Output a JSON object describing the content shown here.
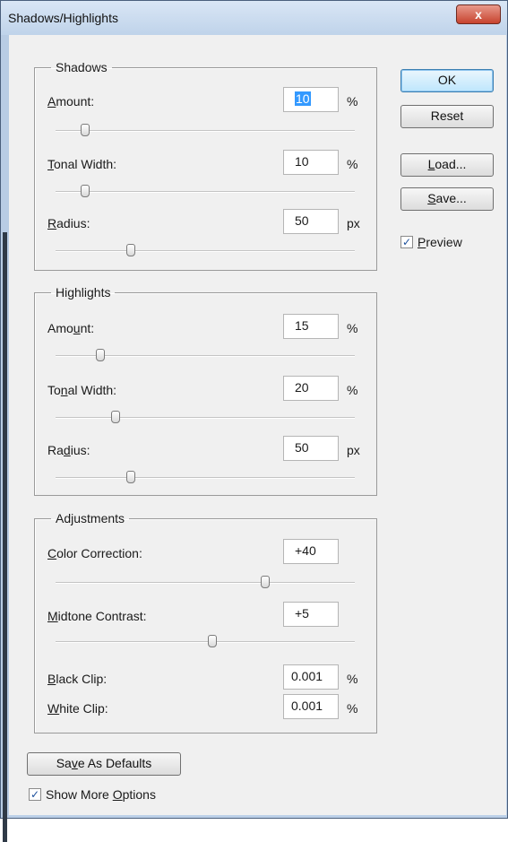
{
  "window": {
    "title": "Shadows/Highlights",
    "close_label": "x"
  },
  "shadows": {
    "legend": "Shadows",
    "amount": {
      "label_pre": "",
      "label_u": "A",
      "label_post": "mount:",
      "value": "10",
      "unit": "%",
      "slider": 0.1
    },
    "tonal_width": {
      "label_pre": "",
      "label_u": "T",
      "label_post": "onal Width:",
      "value": "10",
      "unit": "%",
      "slider": 0.1
    },
    "radius": {
      "label_pre": "",
      "label_u": "R",
      "label_post": "adius:",
      "value": "50",
      "unit": "px",
      "slider": 0.25
    }
  },
  "highlights": {
    "legend": "Highlights",
    "amount": {
      "label_pre": "Amo",
      "label_u": "u",
      "label_post": "nt:",
      "value": "15",
      "unit": "%",
      "slider": 0.15
    },
    "tonal_width": {
      "label_pre": "To",
      "label_u": "n",
      "label_post": "al Width:",
      "value": "20",
      "unit": "%",
      "slider": 0.2
    },
    "radius": {
      "label_pre": "Ra",
      "label_u": "d",
      "label_post": "ius:",
      "value": "50",
      "unit": "px",
      "slider": 0.25
    }
  },
  "adjustments": {
    "legend": "Adjustments",
    "color_correction": {
      "label_pre": "",
      "label_u": "C",
      "label_post": "olor Correction:",
      "value": "+40",
      "slider": 0.7
    },
    "midtone_contrast": {
      "label_pre": "",
      "label_u": "M",
      "label_post": "idtone Contrast:",
      "value": "+5",
      "slider": 0.525
    },
    "black_clip": {
      "label_pre": "",
      "label_u": "B",
      "label_post": "lack Clip:",
      "value": "0.001",
      "unit": "%"
    },
    "white_clip": {
      "label_pre": "",
      "label_u": "W",
      "label_post": "hite Clip:",
      "value": "0.001",
      "unit": "%"
    }
  },
  "buttons": {
    "ok": "OK",
    "reset": "Reset",
    "load": {
      "pre": "",
      "u": "L",
      "post": "oad..."
    },
    "save": {
      "pre": "",
      "u": "S",
      "post": "ave..."
    },
    "save_defaults": {
      "pre": "Sa",
      "u": "v",
      "post": "e As Defaults"
    }
  },
  "preview": {
    "pre": "",
    "u": "P",
    "post": "review",
    "checked": true
  },
  "show_more": {
    "pre": "Show More ",
    "u": "O",
    "post": "ptions",
    "checked": true
  },
  "check_mark": "✓"
}
